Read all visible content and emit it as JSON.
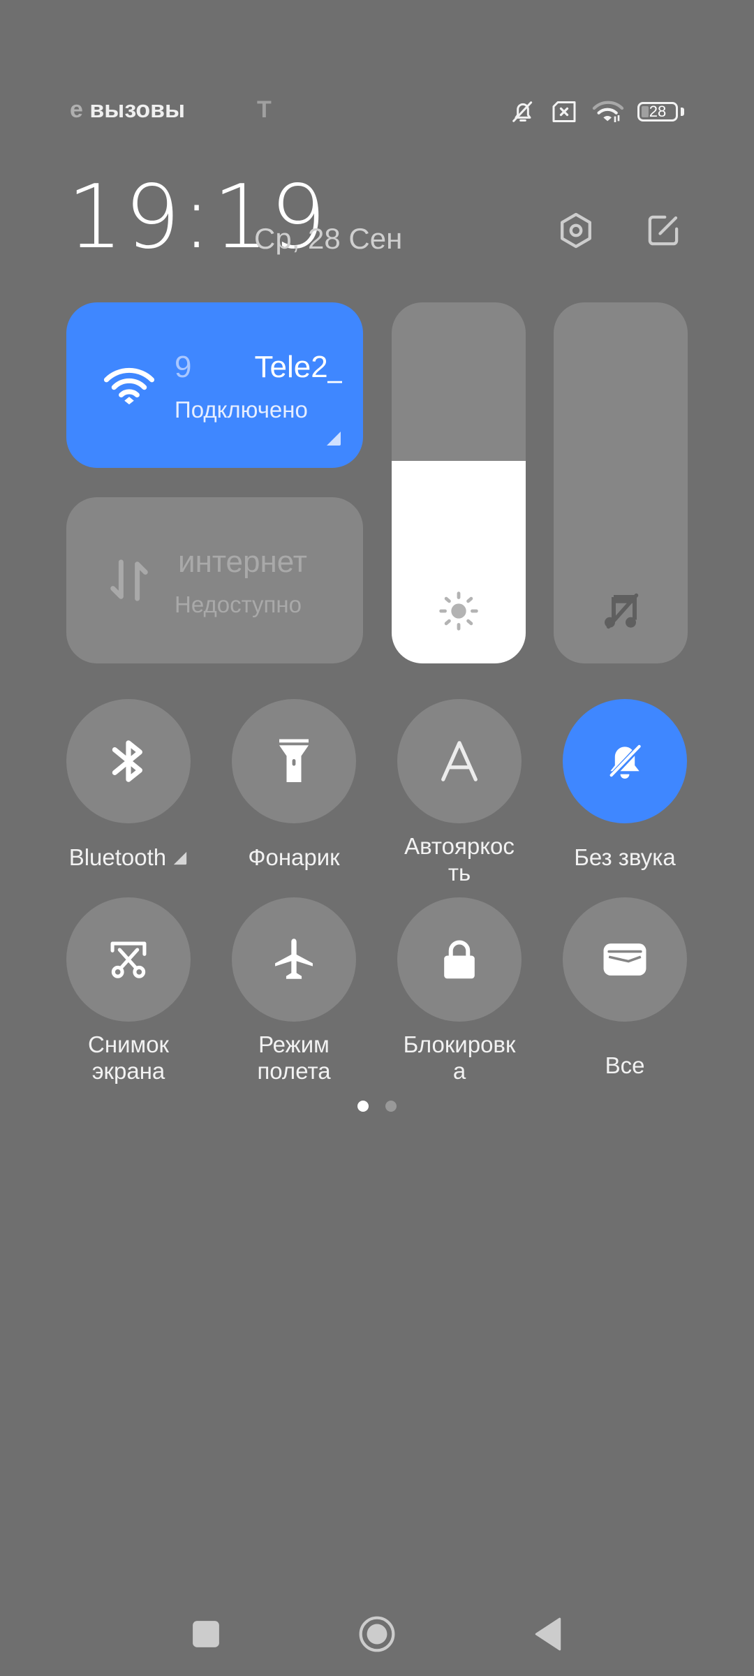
{
  "status_bar": {
    "left_text_fade": "е",
    "left_text": "вызовы",
    "carrier_fragment": "Т",
    "icons": [
      "bell-muted-icon",
      "no-sim-icon",
      "wifi-icon",
      "battery-icon"
    ],
    "battery_level": "28"
  },
  "header": {
    "time": "19:19",
    "date": "Ср, 28 Сен",
    "settings_icon": "settings-hex-icon",
    "edit_icon": "edit-icon"
  },
  "tiles": {
    "wifi": {
      "title_prefix": "9",
      "title": "Tele2_",
      "subtitle": "Подключено",
      "active": true,
      "icon": "wifi-icon"
    },
    "mobile_data": {
      "title": "интернет",
      "subtitle": "Недоступно",
      "active": false,
      "icon": "data-arrows-icon"
    }
  },
  "sliders": {
    "brightness": {
      "value_percent": 56,
      "icon": "sun-icon"
    },
    "volume": {
      "value_percent": 0,
      "icon": "music-muted-icon"
    }
  },
  "toggles": [
    {
      "label": "Bluetooth",
      "icon": "bluetooth-icon",
      "active": false,
      "has_expand": true
    },
    {
      "label": "Фонарик",
      "icon": "flashlight-icon",
      "active": false
    },
    {
      "label": "Автояркос ть",
      "line1": "Автояркос",
      "line2": "ть",
      "icon": "auto-brightness-icon",
      "active": false
    },
    {
      "label": "Без звука",
      "icon": "bell-muted-icon",
      "active": true
    },
    {
      "label": "Снимок экрана",
      "line1": "Снимок",
      "line2": "экрана",
      "icon": "screenshot-icon",
      "active": false
    },
    {
      "label": "Режим полета",
      "line1": "Режим",
      "line2": "полета",
      "icon": "airplane-icon",
      "active": false
    },
    {
      "label": "Блокировк а",
      "line1": "Блокировк",
      "line2": "а",
      "icon": "lock-icon",
      "active": false
    },
    {
      "label": "Все",
      "icon": "wallet-icon",
      "active": false
    }
  ],
  "pagination": {
    "current": 1,
    "total": 2
  },
  "nav_bar": {
    "recents": "recents-icon",
    "home": "home-icon",
    "back": "back-icon"
  },
  "colors": {
    "accent": "#3f87ff",
    "background": "#6f6f6f",
    "tile_inactive": "#868686"
  }
}
